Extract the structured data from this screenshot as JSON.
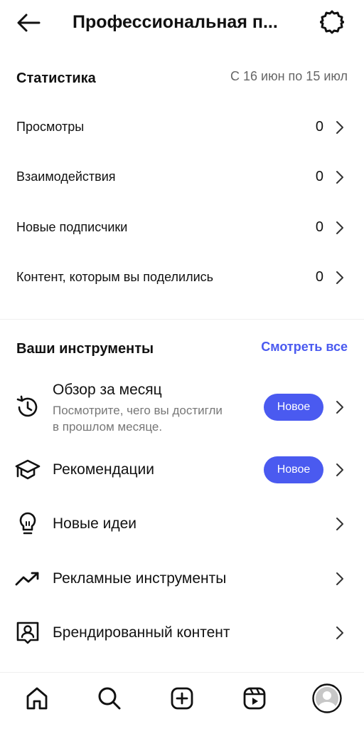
{
  "header": {
    "title": "Профессиональная п...",
    "back_icon": "arrow-left-icon",
    "settings_icon": "gear-icon"
  },
  "statistics": {
    "title": "Статистика",
    "date_range": "С 16 июн по 15 июл",
    "rows": [
      {
        "label": "Просмотры",
        "value": "0"
      },
      {
        "label": "Взаимодействия",
        "value": "0"
      },
      {
        "label": "Новые подписчики",
        "value": "0"
      },
      {
        "label": "Контент, которым вы поделились",
        "value": "0"
      }
    ]
  },
  "tools": {
    "title": "Ваши инструменты",
    "see_all": "Смотреть все",
    "items": [
      {
        "icon": "history-clock-icon",
        "title": "Обзор за месяц",
        "subtitle_line1": "Посмотрите, чего вы достигли",
        "subtitle_line2": "в прошлом месяце.",
        "badge": "Новое"
      },
      {
        "icon": "graduation-cap-icon",
        "title": "Рекомендации",
        "badge": "Новое"
      },
      {
        "icon": "lightbulb-icon",
        "title": "Новые идеи"
      },
      {
        "icon": "trending-up-icon",
        "title": "Рекламные инструменты"
      },
      {
        "icon": "branded-content-icon",
        "title": "Брендированный контент"
      }
    ]
  },
  "colors": {
    "accent": "#4a5af0",
    "muted_text": "#666666"
  },
  "bottom_nav": [
    "home-icon",
    "search-icon",
    "create-icon",
    "reels-icon",
    "profile-avatar-icon"
  ]
}
